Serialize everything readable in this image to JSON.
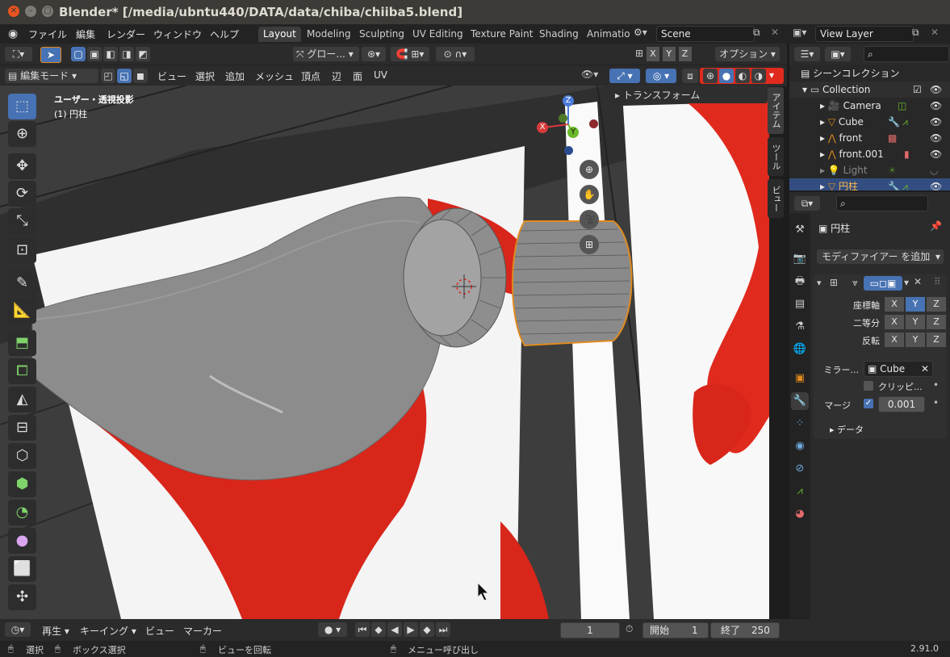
{
  "window": {
    "title": "Blender* [/media/ubntu440/DATA/data/chiba/chiiba5.blend]"
  },
  "menus": [
    "ファイル",
    "編集",
    "レンダー",
    "ウィンドウ",
    "ヘルプ"
  ],
  "workspaces": [
    "Layout",
    "Modeling",
    "Sculpting",
    "UV Editing",
    "Texture Paint",
    "Shading",
    "Animatio"
  ],
  "scene": {
    "name": "Scene",
    "view_layer": "View Layer"
  },
  "header1": {
    "transform_orient": "グロー...",
    "options": "オプション"
  },
  "header2": {
    "mode": "編集モード",
    "menus": [
      "ビュー",
      "選択",
      "追加",
      "メッシュ",
      "頂点",
      "辺",
      "面",
      "UV"
    ]
  },
  "viewport": {
    "view_name": "ユーザー・透視投影",
    "object_name": "(1) 円柱",
    "n_panel": "トランスフォーム",
    "axes": {
      "x": "X",
      "y": "Y",
      "z": "Z"
    },
    "side_tabs": [
      "アイテム",
      "ツール",
      "ビュー"
    ]
  },
  "outliner": {
    "root": "シーンコレクション",
    "collection": "Collection",
    "items": [
      {
        "name": "Camera"
      },
      {
        "name": "Cube"
      },
      {
        "name": "front"
      },
      {
        "name": "front.001"
      },
      {
        "name": "Light"
      },
      {
        "name": "円柱"
      }
    ]
  },
  "properties": {
    "object_name": "円柱",
    "add_modifier": "モディファイアー を追加",
    "axis_label": "座標軸",
    "bisect_label": "二等分",
    "flip_label": "反転",
    "xyz": [
      "X",
      "Y",
      "Z"
    ],
    "mirror_label": "ミラー...",
    "mirror_object": "Cube",
    "clipping_label": "クリッピ...",
    "merge_label": "マージ",
    "merge_value": "0.001",
    "data_label": "データ"
  },
  "timeline": {
    "playback": "再生",
    "keying": "キーイング",
    "view": "ビュー",
    "marker": "マーカー",
    "current_frame": "1",
    "start_label": "開始",
    "start": "1",
    "end_label": "終了",
    "end": "250"
  },
  "statusbar": {
    "select": "選択",
    "box_select": "ボックス選択",
    "rotate": "ビューを回転",
    "menu": "メニュー呼び出し",
    "version": "2.91.0"
  },
  "colors": {
    "accent": "#4772b3",
    "orange": "#e08a1e",
    "red": "#e02a1e"
  }
}
